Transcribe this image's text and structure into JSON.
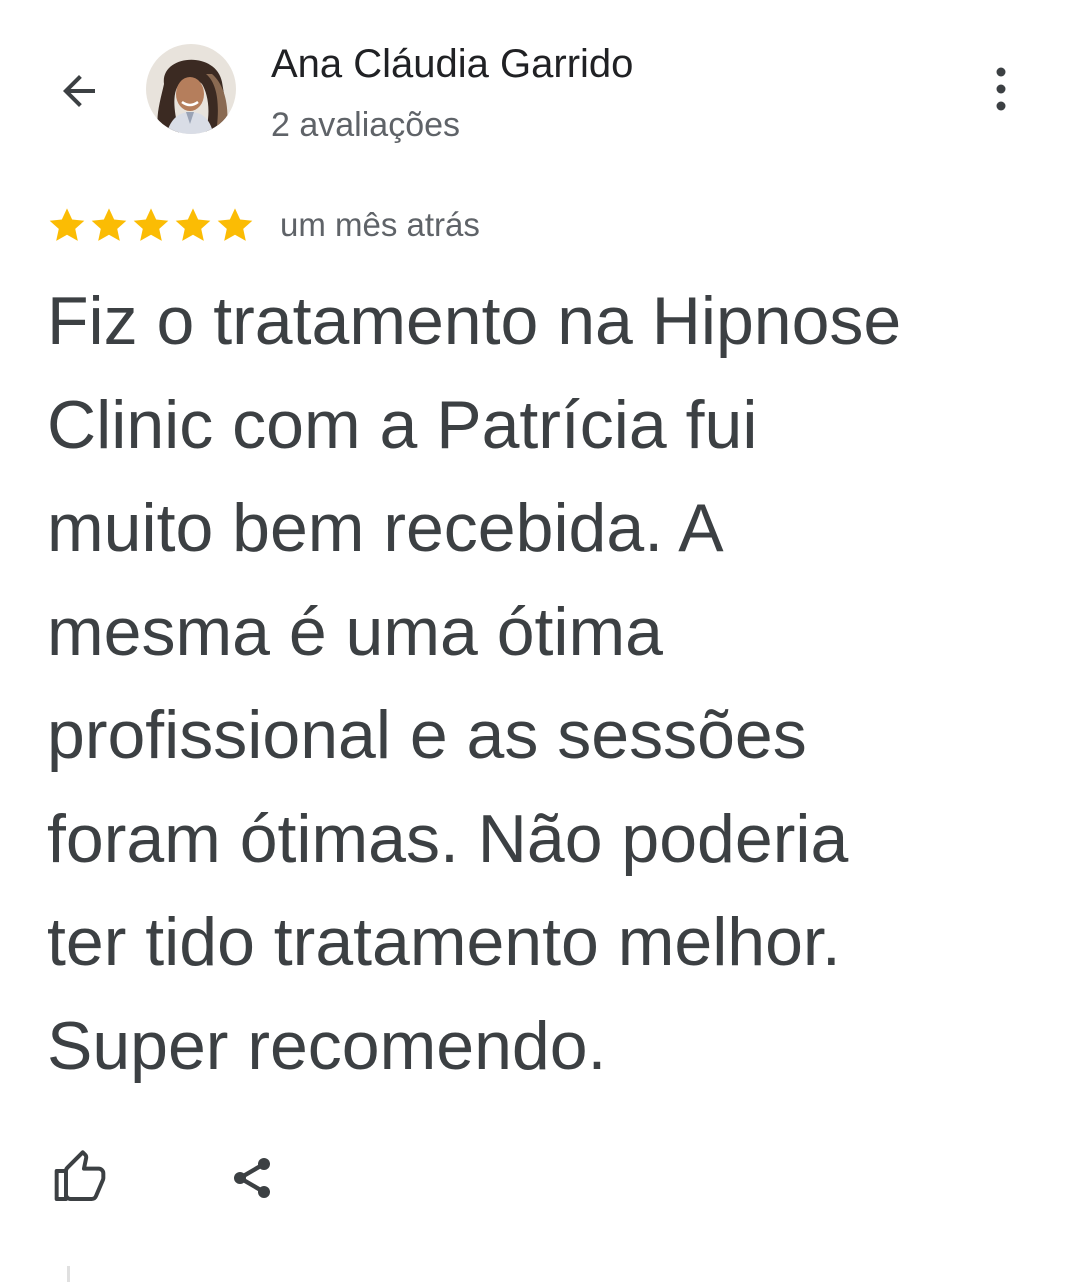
{
  "header": {
    "back_icon": "arrow-back-icon",
    "reviewer_name": "Ana Cláudia Garrido",
    "review_count": "2 avaliações",
    "more_icon": "more-vert-icon"
  },
  "review": {
    "rating": 5,
    "max_rating": 5,
    "star_color": "#fbbc04",
    "date": "um mês atrás",
    "lines": [
      "Fiz o tratamento na Hipnose",
      "Clinic com a Patrícia fui",
      "muito bem recebida. A",
      "mesma é uma ótima",
      "profissional e as sessões",
      "foram ótimas. Não poderia",
      "ter tido tratamento melhor.",
      "Super recomendo."
    ]
  },
  "actions": {
    "like_icon": "thumb-up-icon",
    "share_icon": "share-icon"
  },
  "colors": {
    "text_primary": "#202124",
    "text_body": "#3c4043",
    "text_secondary": "#5f6368"
  }
}
